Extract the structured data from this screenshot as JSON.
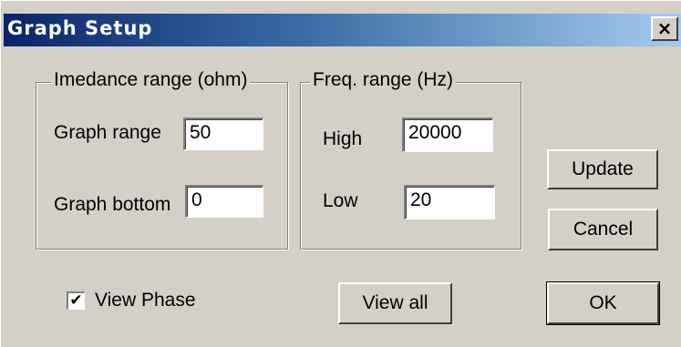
{
  "window": {
    "title": "Graph Setup",
    "close_glyph": "×"
  },
  "impedance_group": {
    "legend": "Imedance range (ohm)",
    "graph_range_label": "Graph range",
    "graph_range_value": "50",
    "graph_bottom_label": "Graph bottom",
    "graph_bottom_value": "0"
  },
  "freq_group": {
    "legend": "Freq. range (Hz)",
    "high_label": "High",
    "high_value": "20000",
    "low_label": "Low",
    "low_value": "20"
  },
  "buttons": {
    "update": "Update",
    "cancel": "Cancel",
    "view_all": "View all",
    "ok": "OK"
  },
  "view_phase": {
    "label": "View Phase",
    "checked": true,
    "check_glyph": "✔"
  }
}
